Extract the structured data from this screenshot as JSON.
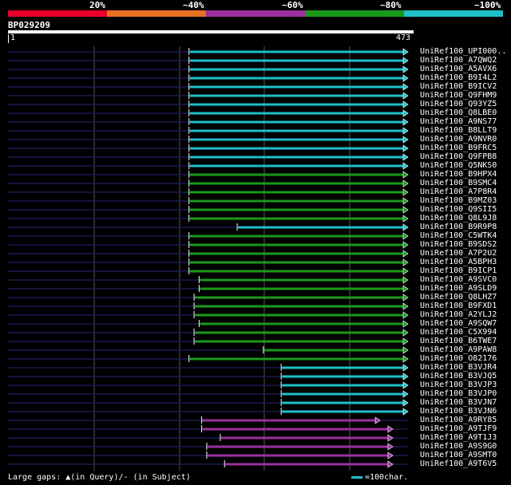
{
  "legend": {
    "labels": [
      "20%",
      "~40%",
      "~60%",
      "~80%",
      "~100%"
    ],
    "colors": [
      "#e8002a",
      "#e87020",
      "#9b2fa0",
      "#1a9a1a",
      "#1ec0c8"
    ]
  },
  "query": {
    "id": "BP029209",
    "start": "1",
    "end": "473",
    "length": 473
  },
  "colors": {
    "grid": "#555555",
    "faint": "#1a1a50"
  },
  "hits": [
    {
      "name": "UniRef100_UPI000..",
      "start": 215,
      "end": 473,
      "color": "#1ec0c8"
    },
    {
      "name": "UniRef100_A7QWQ2",
      "start": 215,
      "end": 473,
      "color": "#1ec0c8"
    },
    {
      "name": "UniRef100_A5AVX6",
      "start": 215,
      "end": 473,
      "color": "#1ec0c8"
    },
    {
      "name": "UniRef100_B9I4L2",
      "start": 215,
      "end": 473,
      "color": "#1ec0c8"
    },
    {
      "name": "UniRef100_B9ICV2",
      "start": 215,
      "end": 473,
      "color": "#1ec0c8"
    },
    {
      "name": "UniRef100_Q9FHM9",
      "start": 215,
      "end": 473,
      "color": "#1ec0c8"
    },
    {
      "name": "UniRef100_Q93YZ5",
      "start": 215,
      "end": 473,
      "color": "#1ec0c8"
    },
    {
      "name": "UniRef100_Q8LBE0",
      "start": 215,
      "end": 473,
      "color": "#1ec0c8"
    },
    {
      "name": "UniRef100_A9NS77",
      "start": 215,
      "end": 473,
      "color": "#1ec0c8"
    },
    {
      "name": "UniRef100_B8LLT9",
      "start": 215,
      "end": 473,
      "color": "#1ec0c8"
    },
    {
      "name": "UniRef100_A9NVR0",
      "start": 215,
      "end": 473,
      "color": "#1ec0c8"
    },
    {
      "name": "UniRef100_B9FRC5",
      "start": 215,
      "end": 473,
      "color": "#1ec0c8"
    },
    {
      "name": "UniRef100_Q9FPB8",
      "start": 215,
      "end": 473,
      "color": "#1ec0c8"
    },
    {
      "name": "UniRef100_Q5NKS0",
      "start": 215,
      "end": 473,
      "color": "#1ec0c8"
    },
    {
      "name": "UniRef100_B9HPX4",
      "start": 215,
      "end": 473,
      "color": "#1a9a1a"
    },
    {
      "name": "UniRef100_B9SMC4",
      "start": 215,
      "end": 473,
      "color": "#1a9a1a"
    },
    {
      "name": "UniRef100_A7P8R4",
      "start": 215,
      "end": 473,
      "color": "#1a9a1a"
    },
    {
      "name": "UniRef100_B9MZ03",
      "start": 215,
      "end": 473,
      "color": "#1a9a1a"
    },
    {
      "name": "UniRef100_Q9SII5",
      "start": 215,
      "end": 473,
      "color": "#1a9a1a"
    },
    {
      "name": "UniRef100_Q8L9J8",
      "start": 215,
      "end": 473,
      "color": "#1a9a1a"
    },
    {
      "name": "UniRef100_B9R9P8",
      "start": 272,
      "end": 473,
      "color": "#1ec0c8"
    },
    {
      "name": "UniRef100_C5WTK4",
      "start": 215,
      "end": 473,
      "color": "#1a9a1a"
    },
    {
      "name": "UniRef100_B9SDS2",
      "start": 215,
      "end": 473,
      "color": "#1a9a1a"
    },
    {
      "name": "UniRef100_A7P2U2",
      "start": 215,
      "end": 473,
      "color": "#1a9a1a"
    },
    {
      "name": "UniRef100_A5BPH3",
      "start": 215,
      "end": 473,
      "color": "#1a9a1a"
    },
    {
      "name": "UniRef100_B9ICP1",
      "start": 215,
      "end": 473,
      "color": "#1a9a1a"
    },
    {
      "name": "UniRef100_A9SVC0",
      "start": 227,
      "end": 473,
      "color": "#1a9a1a"
    },
    {
      "name": "UniRef100_A9SLD9",
      "start": 227,
      "end": 473,
      "color": "#1a9a1a"
    },
    {
      "name": "UniRef100_Q8LHZ7",
      "start": 221,
      "end": 473,
      "color": "#1a9a1a"
    },
    {
      "name": "UniRef100_B9FXD1",
      "start": 221,
      "end": 473,
      "color": "#1a9a1a"
    },
    {
      "name": "UniRef100_A2YLJ2",
      "start": 221,
      "end": 473,
      "color": "#1a9a1a"
    },
    {
      "name": "UniRef100_A9SQW7",
      "start": 227,
      "end": 473,
      "color": "#1a9a1a"
    },
    {
      "name": "UniRef100_C5X994",
      "start": 221,
      "end": 473,
      "color": "#1a9a1a"
    },
    {
      "name": "UniRef100_B6TWE7",
      "start": 221,
      "end": 473,
      "color": "#1a9a1a"
    },
    {
      "name": "UniRef100_A9PAW8",
      "start": 303,
      "end": 473,
      "color": "#1a9a1a"
    },
    {
      "name": "UniRef100_O82176",
      "start": 215,
      "end": 473,
      "color": "#1a9a1a"
    },
    {
      "name": "UniRef100_B3VJR4",
      "start": 324,
      "end": 473,
      "color": "#1ec0c8"
    },
    {
      "name": "UniRef100_B3VJQ5",
      "start": 324,
      "end": 473,
      "color": "#1ec0c8"
    },
    {
      "name": "UniRef100_B3VJP3",
      "start": 324,
      "end": 473,
      "color": "#1ec0c8"
    },
    {
      "name": "UniRef100_B3VJP0",
      "start": 324,
      "end": 473,
      "color": "#1ec0c8"
    },
    {
      "name": "UniRef100_B3VJN7",
      "start": 324,
      "end": 473,
      "color": "#1ec0c8"
    },
    {
      "name": "UniRef100_B3VJN6",
      "start": 324,
      "end": 473,
      "color": "#1ec0c8"
    },
    {
      "name": "UniRef100_A9RY85",
      "start": 230,
      "end": 440,
      "color": "#9b2fa0"
    },
    {
      "name": "UniRef100_A9TJF9",
      "start": 230,
      "end": 455,
      "color": "#9b2fa0"
    },
    {
      "name": "UniRef100_A9T1J3",
      "start": 252,
      "end": 455,
      "color": "#9b2fa0"
    },
    {
      "name": "UniRef100_A9S9G0",
      "start": 236,
      "end": 455,
      "color": "#9b2fa0"
    },
    {
      "name": "UniRef100_A9SMT0",
      "start": 236,
      "end": 455,
      "color": "#9b2fa0"
    },
    {
      "name": "UniRef100_A9T6V5",
      "start": 257,
      "end": 455,
      "color": "#9b2fa0"
    }
  ],
  "footer": {
    "large_gaps_text": "Large gaps: ▲(in Query)/- (in Subject)",
    "scale_text": "=100char.",
    "scale_color": "#1ec0c8"
  }
}
